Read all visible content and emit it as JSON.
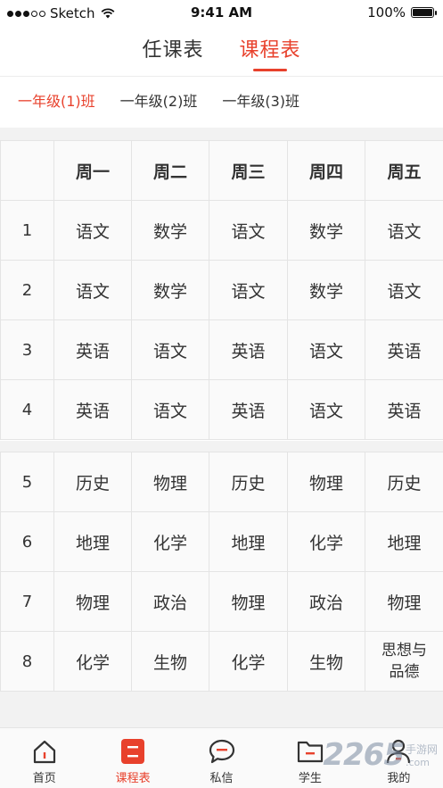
{
  "status_bar": {
    "carrier": "Sketch",
    "time": "9:41 AM",
    "battery": "100%",
    "battery_level": 1.0
  },
  "top_tabs": [
    {
      "label": "任课表",
      "active": false
    },
    {
      "label": "课程表",
      "active": true
    }
  ],
  "class_tabs": [
    {
      "label": "一年级(1)班",
      "active": true
    },
    {
      "label": "一年级(2)班",
      "active": false
    },
    {
      "label": "一年级(3)班",
      "active": false
    }
  ],
  "timetable": {
    "days": [
      "周一",
      "周二",
      "周三",
      "周四",
      "周五"
    ],
    "morning": [
      {
        "period": "1",
        "subjects": [
          "语文",
          "数学",
          "语文",
          "数学",
          "语文"
        ]
      },
      {
        "period": "2",
        "subjects": [
          "语文",
          "数学",
          "语文",
          "数学",
          "语文"
        ]
      },
      {
        "period": "3",
        "subjects": [
          "英语",
          "语文",
          "英语",
          "语文",
          "英语"
        ]
      },
      {
        "period": "4",
        "subjects": [
          "英语",
          "语文",
          "英语",
          "语文",
          "英语"
        ]
      }
    ],
    "afternoon": [
      {
        "period": "5",
        "subjects": [
          "历史",
          "物理",
          "历史",
          "物理",
          "历史"
        ]
      },
      {
        "period": "6",
        "subjects": [
          "地理",
          "化学",
          "地理",
          "化学",
          "地理"
        ]
      },
      {
        "period": "7",
        "subjects": [
          "物理",
          "政治",
          "物理",
          "政治",
          "物理"
        ]
      },
      {
        "period": "8",
        "subjects": [
          "化学",
          "生物",
          "化学",
          "生物",
          "思想与品德"
        ]
      }
    ]
  },
  "bottom_nav": [
    {
      "label": "首页",
      "icon": "home-icon",
      "active": false
    },
    {
      "label": "课程表",
      "icon": "timetable-icon",
      "active": true
    },
    {
      "label": "私信",
      "icon": "message-icon",
      "active": false
    },
    {
      "label": "学生",
      "icon": "folder-icon",
      "active": false
    },
    {
      "label": "我的",
      "icon": "user-icon",
      "active": false
    }
  ],
  "watermark": {
    "number": "2265",
    "text": "手游网",
    "domain": ".com"
  },
  "colors": {
    "accent": "#e8412c",
    "text": "#333333",
    "border": "#e4e4e4",
    "band": "#f2f2f2"
  }
}
